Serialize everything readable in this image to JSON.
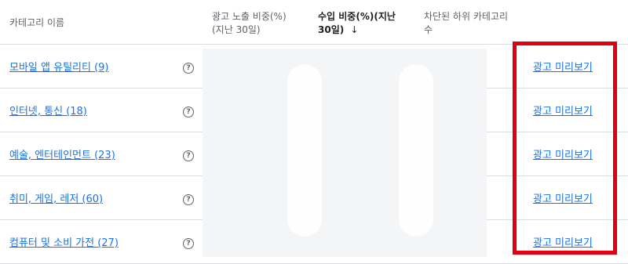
{
  "table": {
    "headers": {
      "category_name": "카테고리 이름",
      "impression_share_line1": "광고 노출 비중(%)",
      "impression_share_line2": "(지난 30일)",
      "revenue_share_line1": "수입 비중(%)(지난",
      "revenue_share_line2": "30일)",
      "blocked_sub_line1": "차단된 하위 카테고리",
      "blocked_sub_line2": "수"
    },
    "sort_icon": "arrow-down-icon",
    "help_glyph": "?",
    "rows": [
      {
        "category": "모바일 앱 유틸리티 (9)",
        "preview": "광고 미리보기"
      },
      {
        "category": "인터넷, 통신 (18)",
        "preview": "광고 미리보기"
      },
      {
        "category": "예술, 엔터테인먼트 (23)",
        "preview": "광고 미리보기"
      },
      {
        "category": "취미, 게임, 레저 (60)",
        "preview": "광고 미리보기"
      },
      {
        "category": "컴퓨터 및 소비 가전 (27)",
        "preview": "광고 미리보기"
      }
    ]
  },
  "colors": {
    "link": "#1a73e8",
    "highlight": "#e1000f",
    "divider": "#dadce0"
  }
}
